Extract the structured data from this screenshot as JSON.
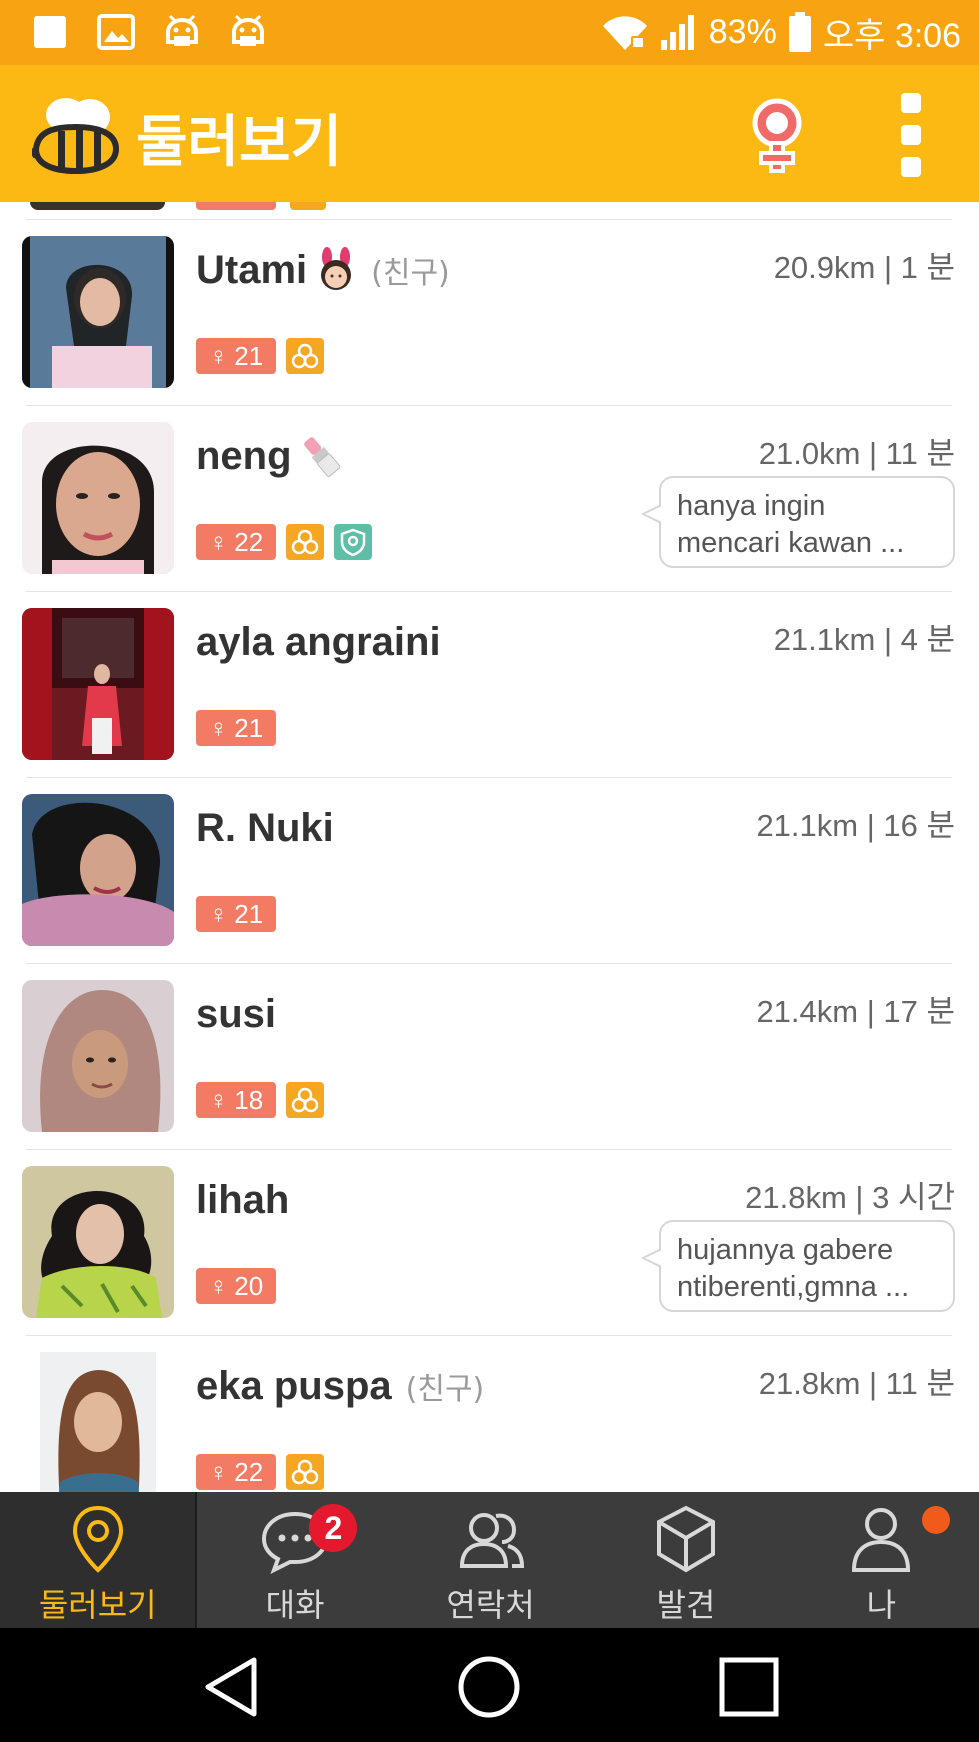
{
  "status_bar": {
    "battery": "83%",
    "time": "오후 3:06",
    "colors": {
      "background": "#f8a312"
    }
  },
  "app_bar": {
    "title": "둘러보기",
    "colors": {
      "background": "#fdb913"
    }
  },
  "users": [
    {
      "name": "Utami",
      "friend": "(친구)",
      "distance_time": "20.9km | 1 분",
      "age": "21",
      "emoji": "bunny-girl",
      "badges": [
        "hexagon"
      ],
      "message": []
    },
    {
      "name": "neng",
      "friend": "",
      "distance_time": "21.0km | 11 분",
      "age": "22",
      "emoji": "lipstick",
      "badges": [
        "hexagon",
        "location-shield"
      ],
      "message": [
        "hanya ingin",
        "mencari kawan ..."
      ]
    },
    {
      "name": "ayla angraini",
      "friend": "",
      "distance_time": "21.1km | 4 분",
      "age": "21",
      "emoji": "",
      "badges": [],
      "message": []
    },
    {
      "name": "R. Nuki",
      "friend": "",
      "distance_time": "21.1km | 16 분",
      "age": "21",
      "emoji": "",
      "badges": [],
      "message": []
    },
    {
      "name": "susi",
      "friend": "",
      "distance_time": "21.4km | 17 분",
      "age": "18",
      "emoji": "",
      "badges": [
        "hexagon"
      ],
      "message": []
    },
    {
      "name": "lihah",
      "friend": "",
      "distance_time": "21.8km | 3 시간",
      "age": "20",
      "emoji": "",
      "badges": [],
      "message": [
        "hujannya gabere",
        "ntiberenti,gmna ..."
      ]
    },
    {
      "name": "eka puspa",
      "friend": "(친구)",
      "distance_time": "21.8km | 11 분",
      "age": "22",
      "emoji": "",
      "badges": [
        "hexagon"
      ],
      "message": []
    }
  ],
  "bottom_nav": [
    {
      "label": "둘러보기",
      "icon": "location-pin-icon",
      "active": true
    },
    {
      "label": "대화",
      "icon": "chat-bubble-icon",
      "badge": "2"
    },
    {
      "label": "연락처",
      "icon": "contacts-icon"
    },
    {
      "label": "발견",
      "icon": "cube-icon"
    },
    {
      "label": "나",
      "icon": "person-icon",
      "dot": true
    }
  ],
  "colors": {
    "accent": "#fdb913",
    "age_badge": "#f47b63",
    "hex_badge": "#f5a623",
    "loc_badge": "#5fbfa6",
    "nav_background": "#3c3c3c",
    "nav_badge": "#e5192d"
  }
}
